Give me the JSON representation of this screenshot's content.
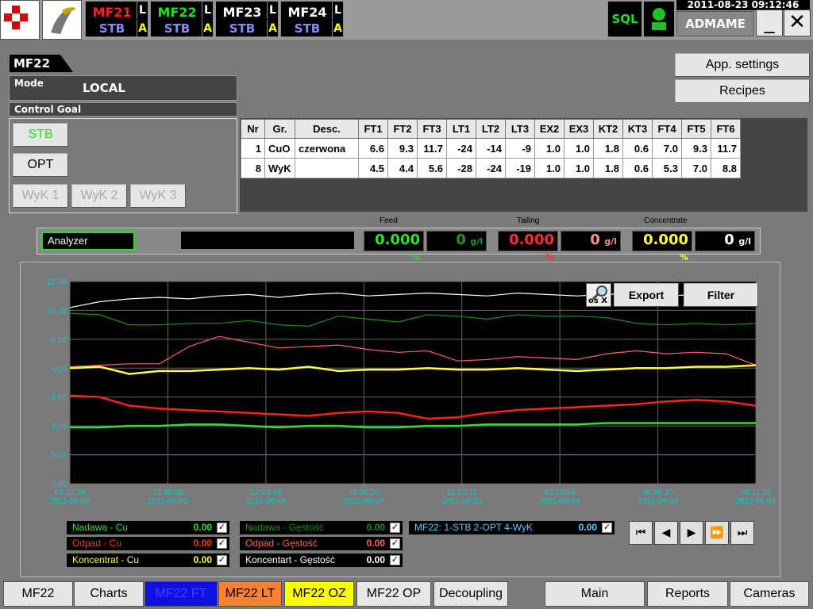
{
  "header": {
    "units": [
      {
        "name": "MF21",
        "status": "STB",
        "name_color": "#ff2020",
        "l": "L",
        "a": "A"
      },
      {
        "name": "MF22",
        "status": "STB",
        "name_color": "#20e020",
        "l": "L",
        "a": "A"
      },
      {
        "name": "MF23",
        "status": "STB",
        "name_color": "#ffffff",
        "l": "L",
        "a": "A"
      },
      {
        "name": "MF24",
        "status": "STB",
        "name_color": "#ffffff",
        "l": "L",
        "a": "A"
      }
    ],
    "sql_label": "SQL",
    "datetime": "2011-08-23  09:12:46",
    "user": "ADMAME",
    "minimize": "_",
    "close": "✕"
  },
  "panel": {
    "title": "MF22",
    "mode_label": "Mode",
    "mode_value": "LOCAL",
    "control_goal_label": "Control Goal",
    "stb_btn": "STB",
    "opt_btn": "OPT",
    "wyk_btns": [
      "WyK 1",
      "WyK 2",
      "WyK 3"
    ]
  },
  "actions": {
    "app_settings": "App. settings",
    "recipes": "Recipes"
  },
  "table": {
    "headers": [
      "Nr",
      "Gr.",
      "Desc.",
      "FT1",
      "FT2",
      "FT3",
      "LT1",
      "LT2",
      "LT3",
      "EX2",
      "EX3",
      "KT2",
      "KT3",
      "FT4",
      "FT5",
      "FT6"
    ],
    "rows": [
      [
        "1",
        "CuO",
        "czerwona",
        "6.6",
        "9.3",
        "11.7",
        "-24",
        "-14",
        "-9",
        "1.0",
        "1.0",
        "1.8",
        "0.6",
        "7.0",
        "9.3",
        "11.7"
      ],
      [
        "8",
        "WyK",
        "",
        "4.5",
        "4.4",
        "5.6",
        "-28",
        "-24",
        "-19",
        "1.0",
        "1.0",
        "1.8",
        "0.6",
        "5.3",
        "7.0",
        "8.8"
      ]
    ]
  },
  "analyzer": {
    "label": "Analyzer",
    "feed_label": "Feed",
    "tailing_label": "Tailing",
    "concentrate_label": "Concentrate",
    "feed_pct": "0.000",
    "feed_gl": "0",
    "tail_pct": "0.000",
    "tail_gl": "0",
    "conc_pct": "0.000",
    "conc_gl": "0",
    "pct_unit": "%",
    "gl_unit": "g/l"
  },
  "chart_data": {
    "type": "line",
    "ylim": [
      -2,
      12
    ],
    "yticks": [
      "12.00",
      "10.00",
      "8.00",
      "6.00",
      "4.00",
      "2.00",
      "0.00",
      "-2.00"
    ],
    "xticks": [
      {
        "time": "09:12:20",
        "date": "2011-08-03"
      },
      {
        "time": "12:38:02",
        "date": "2011-08-03"
      },
      {
        "time": "16:03:45",
        "date": "2011-08-03"
      },
      {
        "time": "19:29:28",
        "date": "2011-08-03"
      },
      {
        "time": "22:55:11",
        "date": "2011-08-03"
      },
      {
        "time": "02:20:54",
        "date": "2011-08-04"
      },
      {
        "time": "05:46:37",
        "date": "2011-08-04"
      },
      {
        "time": "09:12:19",
        "date": "2011-08-04"
      }
    ],
    "series": [
      {
        "color": "#ffffff",
        "values": [
          10.2,
          10.6,
          10.8,
          10.9,
          10.8,
          11.0,
          11.1,
          10.9,
          11.1,
          11.2,
          11.0,
          11.1,
          11.2,
          11.1,
          11.0,
          11.2,
          11.1,
          11.0,
          11.1,
          11.2,
          11.0,
          11.1,
          11.0,
          11.1
        ]
      },
      {
        "color": "#1a8f1a",
        "values": [
          9.8,
          9.7,
          9.0,
          9.0,
          9.1,
          9.1,
          9.3,
          9.0,
          8.9,
          9.6,
          9.4,
          9.2,
          9.7,
          9.6,
          9.4,
          9.7,
          9.6,
          9.6,
          9.5,
          9.1,
          9.0,
          9.1,
          9.0,
          9.1
        ]
      },
      {
        "color": "#ff6060",
        "values": [
          6.1,
          6.2,
          6.3,
          6.3,
          7.5,
          8.2,
          7.8,
          7.4,
          7.5,
          7.6,
          7.3,
          7.1,
          7.2,
          6.5,
          6.6,
          6.8,
          6.7,
          6.6,
          7.0,
          7.2,
          7.0,
          7.1,
          7.0,
          6.2
        ]
      },
      {
        "color": "#ffff40",
        "values": [
          6.0,
          6.1,
          5.6,
          5.8,
          5.8,
          5.9,
          6.0,
          5.9,
          6.1,
          5.8,
          5.9,
          5.9,
          6.0,
          5.9,
          5.9,
          6.0,
          5.9,
          5.8,
          5.9,
          6.0,
          6.0,
          6.1,
          6.1,
          6.2
        ]
      },
      {
        "color": "#ff2020",
        "values": [
          4.1,
          4.0,
          3.4,
          3.2,
          3.1,
          3.0,
          2.9,
          2.8,
          2.7,
          2.9,
          3.0,
          2.9,
          2.5,
          2.6,
          2.9,
          3.1,
          3.2,
          3.3,
          3.4,
          3.5,
          3.7,
          3.8,
          3.7,
          3.4
        ]
      },
      {
        "color": "#30e030",
        "values": [
          1.9,
          1.9,
          2.0,
          2.0,
          2.1,
          2.1,
          2.0,
          1.9,
          2.0,
          2.0,
          1.9,
          1.9,
          2.0,
          2.0,
          2.1,
          2.1,
          2.1,
          2.1,
          2.2,
          2.2,
          2.2,
          2.2,
          2.2,
          2.2
        ]
      }
    ]
  },
  "chart_buttons": {
    "zoom_label": "os X",
    "export": "Export",
    "filter": "Filter"
  },
  "legend": [
    {
      "label": "Nadawa - Cu",
      "value": "0.00",
      "color": "#30e030"
    },
    {
      "label": "Nadawa - Gęstość",
      "value": "0.00",
      "color": "#1a8f1a"
    },
    {
      "label": "MF22: 1-STB 2-OPT 4-WyK",
      "value": "0.00",
      "color": "#5ec8ff"
    },
    {
      "label": "Odpad - Cu",
      "value": "0.00",
      "color": "#ff3030"
    },
    {
      "label": "Odpad - Gęstość",
      "value": "0.00",
      "color": "#ff6060"
    },
    {
      "label": "Koncentrat - Cu",
      "value": "0.00",
      "color": "#ffff40"
    },
    {
      "label": "Koncentart - Gęstość",
      "value": "0.00",
      "color": "#ffffff"
    }
  ],
  "tabs": [
    {
      "label": "MF22",
      "bg": "#e6e6e6",
      "fg": "#000000"
    },
    {
      "label": "Charts",
      "bg": "#e6e6e6",
      "fg": "#000000"
    },
    {
      "label": "MF22 FT",
      "bg": "#1010e0",
      "fg": "#4040ff"
    },
    {
      "label": "MF22 LT",
      "bg": "#ff8030",
      "fg": "#000000"
    },
    {
      "label": "MF22 OZ",
      "bg": "#ffff00",
      "fg": "#000000"
    },
    {
      "label": "MF22 OP",
      "bg": "#e6e6e6",
      "fg": "#000000"
    },
    {
      "label": "Decoupling",
      "bg": "#e6e6e6",
      "fg": "#000000"
    },
    {
      "label": "Main",
      "bg": "#e6e6e6",
      "fg": "#000000"
    },
    {
      "label": "Reports",
      "bg": "#e6e6e6",
      "fg": "#000000"
    },
    {
      "label": "Cameras",
      "bg": "#e6e6e6",
      "fg": "#000000"
    }
  ]
}
